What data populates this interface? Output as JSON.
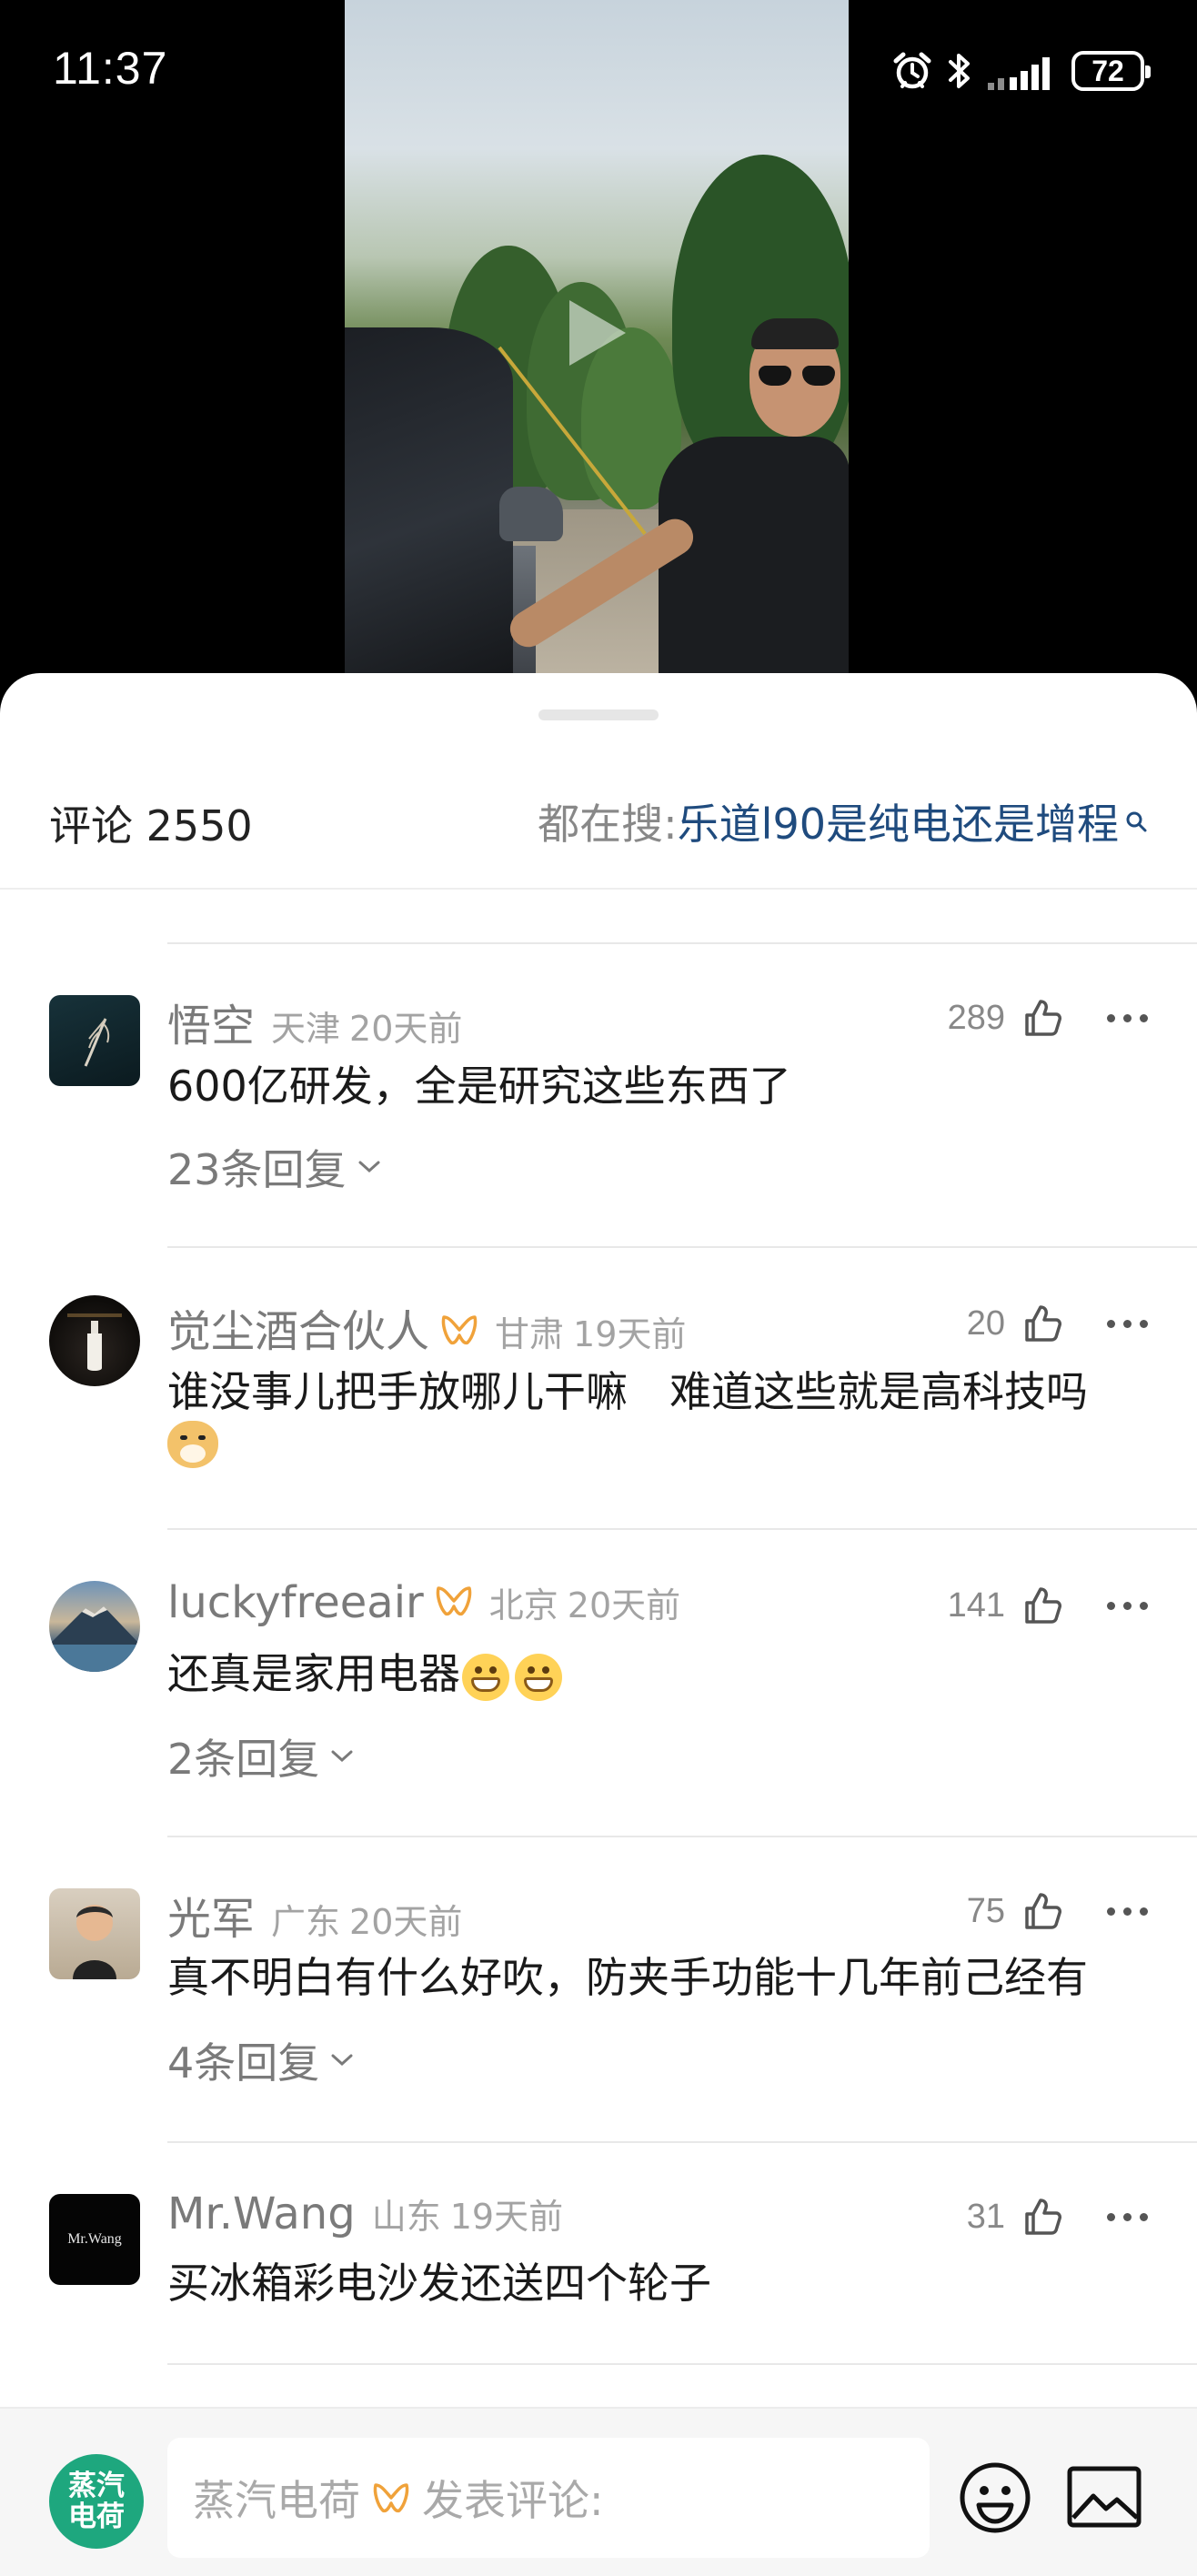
{
  "status_bar": {
    "time": "11:37",
    "battery": "72",
    "icons": [
      "alarm-icon",
      "bluetooth-icon",
      "signal-icon",
      "battery-icon"
    ]
  },
  "video": {
    "play_icon": "play-icon"
  },
  "sheet": {
    "comment_count_label": "评论 2550",
    "hot_search_prefix": "都在搜: ",
    "hot_search_term": "乐道l90是纯电还是增程",
    "search_icon": "search-icon"
  },
  "comments": [
    {
      "name": "悟空",
      "location": "天津",
      "time": "20天前",
      "likes": "289",
      "text": "600亿研发，全是研究这些东西了",
      "replies": "23条回复",
      "vip": false
    },
    {
      "name": "觉尘酒合伙人",
      "location": "甘肃",
      "time": "19天前",
      "likes": "20",
      "text_line1": "谁没事儿把手放哪儿干嘛　难道这些就是高科技吗",
      "vip": true
    },
    {
      "name": "luckyfreeair",
      "location": "北京",
      "time": "20天前",
      "likes": "141",
      "text": "还真是家用电器",
      "replies": "2条回复",
      "vip": true
    },
    {
      "name": "光军",
      "location": "广东",
      "time": "20天前",
      "likes": "75",
      "text": "真不明白有什么好吹，防夹手功能十几年前己经有",
      "replies": "4条回复",
      "vip": false
    },
    {
      "name": "Mr.Wang",
      "location": "山东",
      "time": "19天前",
      "likes": "31",
      "text": "买冰箱彩电沙发还送四个轮子",
      "avatar_text": "Mr.Wang",
      "vip": false
    }
  ],
  "bottom_bar": {
    "my_avatar_text": "蒸汽电荷",
    "input_username": "蒸汽电荷",
    "input_placeholder": "发表评论:",
    "emoji_button_icon": "emoji-icon",
    "image_button_icon": "image-icon"
  },
  "colors": {
    "link_blue": "#1f4b7e",
    "vip_orange": "#f0a23a",
    "avatar_green": "#1ea77e"
  }
}
